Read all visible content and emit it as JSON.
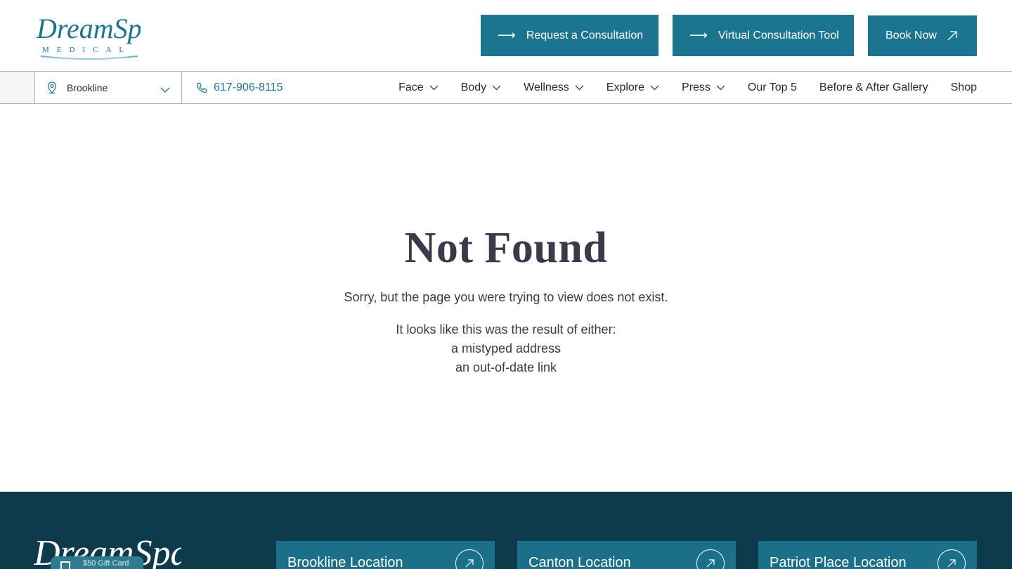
{
  "brand": {
    "logo_text": "DreamSpa",
    "logo_subtext": "MEDICAL",
    "accent": "#1b7490",
    "footer_bg": "#0d3b4c"
  },
  "header": {
    "cta_consultation": "Request a Consultation",
    "cta_virtual": "Virtual Consultation Tool",
    "cta_book": "Book Now"
  },
  "navbar": {
    "location": "Brookline",
    "phone": "617-906-8115",
    "items": [
      {
        "label": "Face",
        "dropdown": true
      },
      {
        "label": "Body",
        "dropdown": true
      },
      {
        "label": "Wellness",
        "dropdown": true
      },
      {
        "label": "Explore",
        "dropdown": true
      },
      {
        "label": "Press",
        "dropdown": true
      },
      {
        "label": "Our Top 5",
        "dropdown": false
      },
      {
        "label": "Before & After Gallery",
        "dropdown": false
      },
      {
        "label": "Shop",
        "dropdown": false
      }
    ]
  },
  "main": {
    "title": "Not Found",
    "sorry": "Sorry, but the page you were trying to view does not exist.",
    "lines": [
      "It looks like this was the result of either:",
      "a mistyped address",
      "an out-of-date link"
    ]
  },
  "footer": {
    "gift_card": "$50 Gift Card",
    "locations": [
      {
        "name": "Brookline Location"
      },
      {
        "name": "Canton Location"
      },
      {
        "name": "Patriot Place Location"
      }
    ]
  }
}
